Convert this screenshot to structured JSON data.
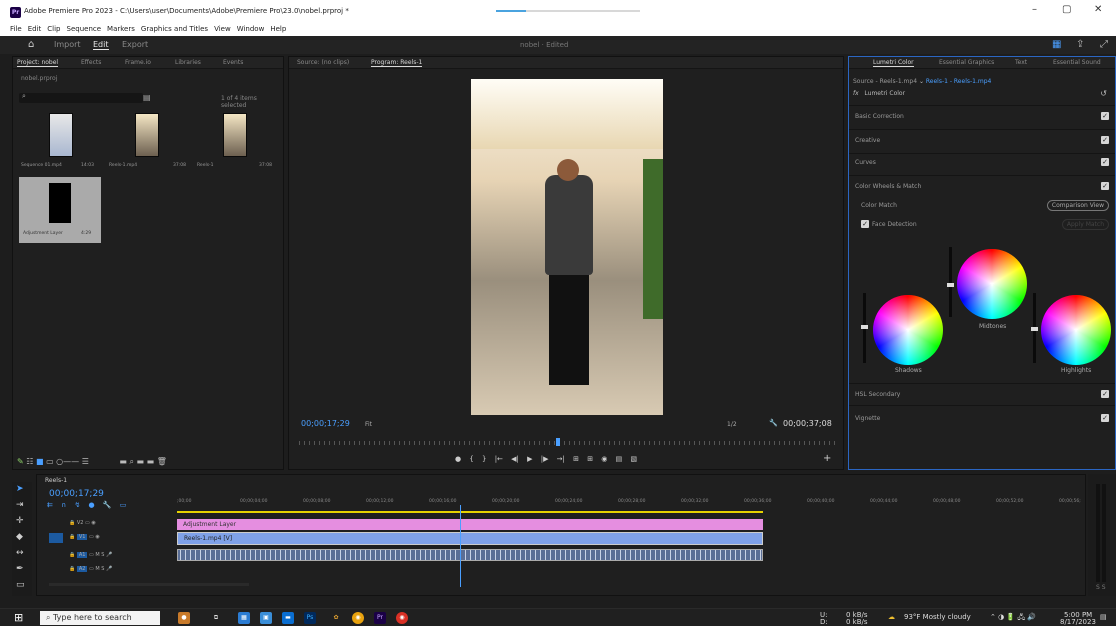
{
  "window": {
    "title": "Adobe Premiere Pro 2023 - C:\\Users\\user\\Documents\\Adobe\\Premiere Pro\\23.0\\nobel.prproj *",
    "app_badge": "Pr"
  },
  "menu": [
    "File",
    "Edit",
    "Clip",
    "Sequence",
    "Markers",
    "Graphics and Titles",
    "View",
    "Window",
    "Help"
  ],
  "workspace": {
    "tabs": [
      "Import",
      "Edit",
      "Export"
    ],
    "active": "Edit",
    "project_name": "nobel",
    "status": "Edited"
  },
  "project": {
    "tabs": [
      "Project: nobel",
      "Effects",
      "Frame.io",
      "Libraries",
      "Events"
    ],
    "file": "nobel.prproj",
    "selection": "1 of 4 items selected",
    "items": [
      {
        "name": "Sequence 01.mp4",
        "duration": "14:03"
      },
      {
        "name": "Reels-1.mp4",
        "duration": "37:08"
      },
      {
        "name": "Reels-1",
        "duration": "37:08"
      },
      {
        "name": "Adjustment Layer",
        "duration": "4:29"
      }
    ]
  },
  "program": {
    "tabs": [
      "Source: (no clips)",
      "Program: Reels-1"
    ],
    "timecode": "00;00;17;29",
    "fit": "Fit",
    "resolution": "1/2",
    "duration": "00;00;37;08",
    "playhead_fraction": 0.48
  },
  "lumetri": {
    "tabs": [
      "Lumetri Color",
      "Essential Graphics",
      "Text",
      "Essential Sound"
    ],
    "source_label": "Source - Reels-1.mp4",
    "source_link": "Reels-1 - Reels-1.mp4",
    "effect": "Lumetri Color",
    "fx": "fx",
    "sections": [
      "Basic Correction",
      "Creative",
      "Curves",
      "Color Wheels & Match"
    ],
    "color_match": "Color Match",
    "comparison_view": "Comparison View",
    "face_detection": "Face Detection",
    "apply_match": "Apply Match",
    "wheels": [
      "Shadows",
      "Midtones",
      "Highlights"
    ],
    "bottom_sections": [
      "HSL Secondary",
      "Vignette"
    ]
  },
  "timeline": {
    "tab": "Reels-1",
    "timecode": "00;00;17;29",
    "ruler": [
      ";00;00",
      "00;00;04;00",
      "00;00;08;00",
      "00;00;12;00",
      "00;00;16;00",
      "00;00;20;00",
      "00;00;24;00",
      "00;00;28;00",
      "00;00;32;00",
      "00;00;36;00",
      "00;00;40;00",
      "00;00;44;00",
      "00;00;48;00",
      "00;00;52;00",
      "00;00;56;"
    ],
    "tracks": [
      "V2",
      "V1",
      "A1",
      "A2"
    ],
    "clips": [
      {
        "label": "Adjustment Layer",
        "color": "#e58ee0"
      },
      {
        "label": "Reels-1.mp4 [V]",
        "color": "#7fa1e8"
      }
    ]
  },
  "taskbar": {
    "search_placeholder": "Type here to search",
    "weather": "93°F  Mostly cloudy",
    "time": "5:00 PM",
    "date": "8/17/2023",
    "net_up": "0 kB/s",
    "net_down": "0 kB/s",
    "net_u": "U:",
    "net_d": "D:"
  },
  "colors": {
    "accent": "#2b66c3",
    "timecode": "#4a9fff"
  }
}
